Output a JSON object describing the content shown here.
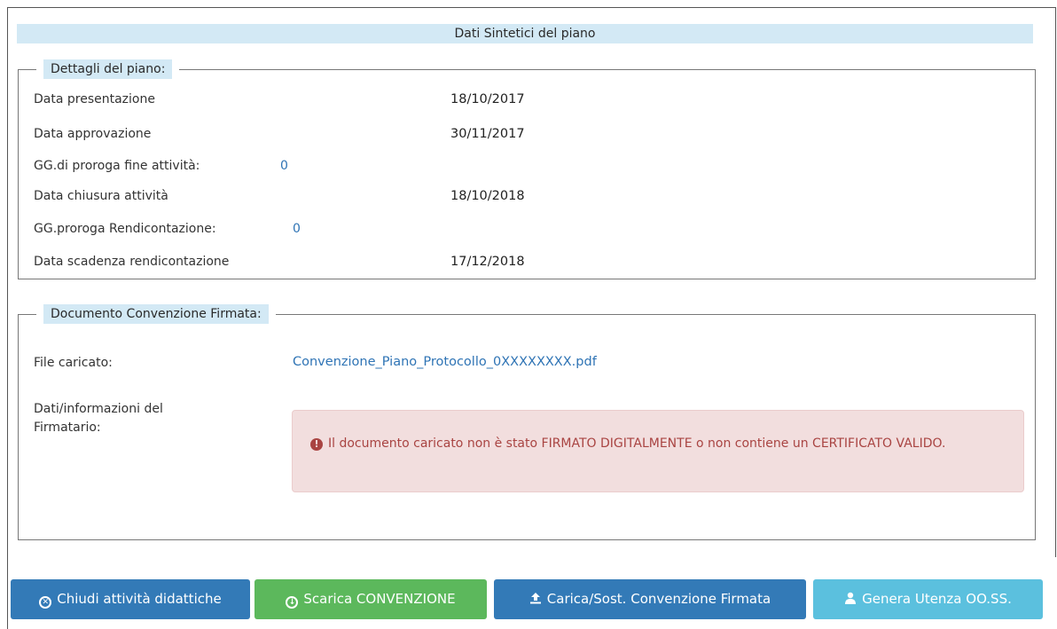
{
  "header": {
    "title": "Dati Sintetici del piano"
  },
  "details": {
    "legend": "Dettagli del piano:",
    "rows": [
      {
        "label": "Data presentazione",
        "value": "18/10/2017"
      },
      {
        "label": "Data approvazione",
        "value": "30/11/2017"
      },
      {
        "label": "GG.di proroga fine attività:",
        "value": "0"
      },
      {
        "label": "Data chiusura attività",
        "value": "18/10/2018"
      },
      {
        "label": "GG.proroga Rendicontazione:",
        "value": "0"
      },
      {
        "label": "Data scadenza rendicontazione",
        "value": "17/12/2018"
      }
    ]
  },
  "document": {
    "legend": "Documento Convenzione Firmata:",
    "file_label": "File caricato:",
    "file_name": "Convenzione_Piano_Protocollo_0XXXXXXXX.pdf",
    "signer_label_line1": "Dati/informazioni del",
    "signer_label_line2": "Firmatario:",
    "alert": {
      "prefix": "Il documento caricato ",
      "emphasis1": "non è stato FIRMATO DIGITALMENTE",
      "middle": " o ",
      "emphasis2": "non contiene un CERTIFICATO VALIDO",
      "suffix": ".",
      "icon": "exclamation-circle-icon",
      "color": "#a94442",
      "background": "#f2dede"
    }
  },
  "actions": {
    "close_label": "Chiudi attività didattiche",
    "download_label": "Scarica CONVENZIONE",
    "upload_label": "Carica/Sost. Convenzione Firmata",
    "user_label": "Genera Utenza OO.SS."
  },
  "colors": {
    "primary": "#337ab7",
    "success": "#5cb85c",
    "info": "#5bc0de",
    "header_bg": "#d3e9f5",
    "link": "#2f74b5"
  }
}
